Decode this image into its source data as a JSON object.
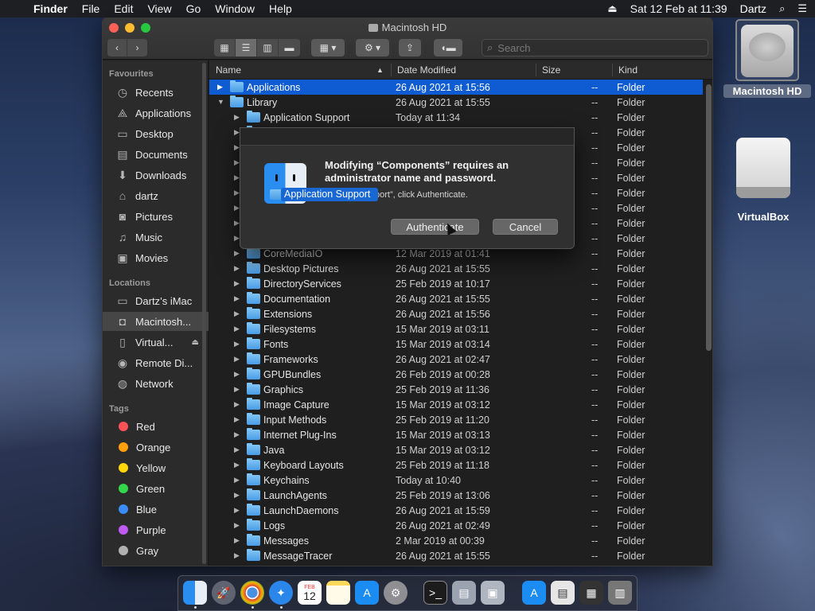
{
  "menubar": {
    "app": "Finder",
    "items": [
      "File",
      "Edit",
      "View",
      "Go",
      "Window",
      "Help"
    ],
    "datetime": "Sat 12 Feb at 11:39",
    "user": "Dartz"
  },
  "window": {
    "title": "Macintosh HD",
    "search_placeholder": "Search"
  },
  "sidebar": {
    "favourites_heading": "Favourites",
    "favourites": [
      "Recents",
      "Applications",
      "Desktop",
      "Documents",
      "Downloads",
      "dartz",
      "Pictures",
      "Music",
      "Movies"
    ],
    "locations_heading": "Locations",
    "locations": [
      "Dartz’s iMac",
      "Macintosh...",
      "Virtual...",
      "Remote Di...",
      "Network"
    ],
    "tags_heading": "Tags",
    "tags": [
      {
        "name": "Red",
        "color": "#ff5257"
      },
      {
        "name": "Orange",
        "color": "#ff9f0a"
      },
      {
        "name": "Yellow",
        "color": "#ffd60a"
      },
      {
        "name": "Green",
        "color": "#32d74b"
      },
      {
        "name": "Blue",
        "color": "#3b8cf6"
      },
      {
        "name": "Purple",
        "color": "#bf5af2"
      },
      {
        "name": "Gray",
        "color": "#b0b0b0"
      }
    ]
  },
  "list": {
    "columns": {
      "name": "Name",
      "date": "Date Modified",
      "size": "Size",
      "kind": "Kind"
    },
    "rows": [
      {
        "name": "Applications",
        "date": "26 Aug 2021 at 15:56",
        "size": "--",
        "kind": "Folder",
        "level": 0,
        "open": false,
        "selected": true
      },
      {
        "name": "Library",
        "date": "26 Aug 2021 at 15:55",
        "size": "--",
        "kind": "Folder",
        "level": 0,
        "open": true
      },
      {
        "name": "Application Support",
        "date": "Today at 11:34",
        "size": "--",
        "kind": "Folder",
        "level": 1
      },
      {
        "name": "",
        "date": "",
        "size": "--",
        "kind": "Folder",
        "level": 1
      },
      {
        "name": "",
        "date": "",
        "size": "--",
        "kind": "Folder",
        "level": 1
      },
      {
        "name": "",
        "date": "",
        "size": "--",
        "kind": "Folder",
        "level": 1
      },
      {
        "name": "",
        "date": "",
        "size": "--",
        "kind": "Folder",
        "level": 1
      },
      {
        "name": "",
        "date": "",
        "size": "--",
        "kind": "Folder",
        "level": 1
      },
      {
        "name": "",
        "date": "",
        "size": "--",
        "kind": "Folder",
        "level": 1
      },
      {
        "name": "",
        "date": "",
        "size": "--",
        "kind": "Folder",
        "level": 1
      },
      {
        "name": "",
        "date": "",
        "size": "--",
        "kind": "Folder",
        "level": 1
      },
      {
        "name": "CoreMediaIO",
        "date": "12 Mar 2019 at 01:41",
        "size": "--",
        "kind": "Folder",
        "level": 1
      },
      {
        "name": "Desktop Pictures",
        "date": "26 Aug 2021 at 15:55",
        "size": "--",
        "kind": "Folder",
        "level": 1
      },
      {
        "name": "DirectoryServices",
        "date": "25 Feb 2019 at 10:17",
        "size": "--",
        "kind": "Folder",
        "level": 1
      },
      {
        "name": "Documentation",
        "date": "26 Aug 2021 at 15:55",
        "size": "--",
        "kind": "Folder",
        "level": 1
      },
      {
        "name": "Extensions",
        "date": "26 Aug 2021 at 15:56",
        "size": "--",
        "kind": "Folder",
        "level": 1
      },
      {
        "name": "Filesystems",
        "date": "15 Mar 2019 at 03:11",
        "size": "--",
        "kind": "Folder",
        "level": 1
      },
      {
        "name": "Fonts",
        "date": "15 Mar 2019 at 03:14",
        "size": "--",
        "kind": "Folder",
        "level": 1
      },
      {
        "name": "Frameworks",
        "date": "26 Aug 2021 at 02:47",
        "size": "--",
        "kind": "Folder",
        "level": 1
      },
      {
        "name": "GPUBundles",
        "date": "26 Feb 2019 at 00:28",
        "size": "--",
        "kind": "Folder",
        "level": 1
      },
      {
        "name": "Graphics",
        "date": "25 Feb 2019 at 11:36",
        "size": "--",
        "kind": "Folder",
        "level": 1
      },
      {
        "name": "Image Capture",
        "date": "15 Mar 2019 at 03:12",
        "size": "--",
        "kind": "Folder",
        "level": 1
      },
      {
        "name": "Input Methods",
        "date": "25 Feb 2019 at 11:20",
        "size": "--",
        "kind": "Folder",
        "level": 1
      },
      {
        "name": "Internet Plug-Ins",
        "date": "15 Mar 2019 at 03:13",
        "size": "--",
        "kind": "Folder",
        "level": 1
      },
      {
        "name": "Java",
        "date": "15 Mar 2019 at 03:12",
        "size": "--",
        "kind": "Folder",
        "level": 1
      },
      {
        "name": "Keyboard Layouts",
        "date": "25 Feb 2019 at 11:18",
        "size": "--",
        "kind": "Folder",
        "level": 1
      },
      {
        "name": "Keychains",
        "date": "Today at 10:40",
        "size": "--",
        "kind": "Folder",
        "level": 1
      },
      {
        "name": "LaunchAgents",
        "date": "25 Feb 2019 at 13:06",
        "size": "--",
        "kind": "Folder",
        "level": 1
      },
      {
        "name": "LaunchDaemons",
        "date": "26 Aug 2021 at 15:59",
        "size": "--",
        "kind": "Folder",
        "level": 1
      },
      {
        "name": "Logs",
        "date": "26 Aug 2021 at 02:49",
        "size": "--",
        "kind": "Folder",
        "level": 1
      },
      {
        "name": "Messages",
        "date": "2 Mar 2019 at 00:39",
        "size": "--",
        "kind": "Folder",
        "level": 1
      },
      {
        "name": "MessageTracer",
        "date": "26 Aug 2021 at 15:55",
        "size": "--",
        "kind": "Folder",
        "level": 1
      }
    ]
  },
  "dialog": {
    "title": "Modifying “Components” requires an administrator name and password.",
    "message": "plication Support”, click Authenticate.",
    "drag_label": "Application Support",
    "authenticate_label": "Authenticate",
    "cancel_label": "Cancel"
  },
  "desktop": {
    "icons": [
      "Macintosh HD",
      "VirtualBox"
    ]
  },
  "dock": {
    "calendar_month": "FEB",
    "calendar_day": "12"
  }
}
